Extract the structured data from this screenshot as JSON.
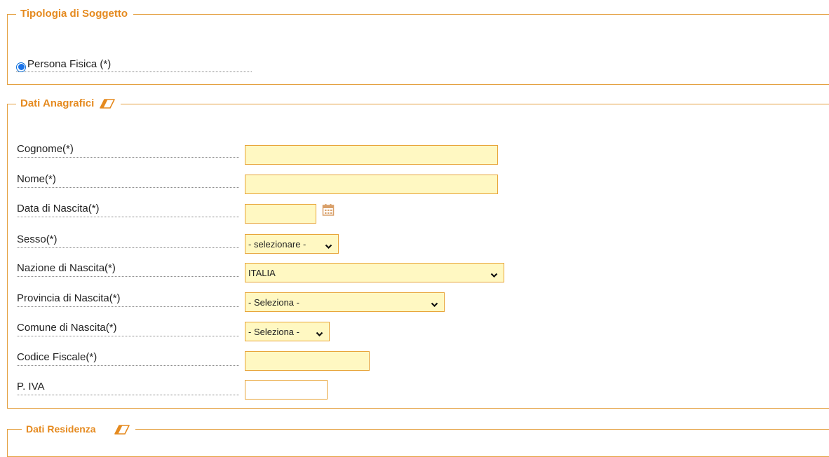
{
  "tipologia": {
    "legend": "Tipologia di Soggetto",
    "radio_label": "Persona Fisica (*)",
    "radio_selected": true
  },
  "anagrafici": {
    "legend": "Dati Anagrafici",
    "legend_icon": "eraser-icon",
    "fields": {
      "cognome": {
        "label": "Cognome(*)",
        "value": ""
      },
      "nome": {
        "label": "Nome(*)",
        "value": ""
      },
      "data_nascita": {
        "label": "Data di Nascita(*)",
        "value": "",
        "icon": "calendar-icon"
      },
      "sesso": {
        "label": "Sesso(*)",
        "selected": "- selezionare -"
      },
      "nazione": {
        "label": "Nazione di Nascita(*)",
        "selected": "ITALIA"
      },
      "provincia": {
        "label": "Provincia di Nascita(*)",
        "selected": "- Seleziona -"
      },
      "comune": {
        "label": "Comune di Nascita(*)",
        "selected": "- Seleziona -"
      },
      "codice_fiscale": {
        "label": "Codice Fiscale(*)",
        "value": ""
      },
      "piva": {
        "label": "P. IVA",
        "value": ""
      }
    }
  },
  "residenza": {
    "legend": "Dati Residenza",
    "legend_icon": "eraser-icon"
  },
  "colors": {
    "accent": "#e58a1f",
    "border": "#e4a040",
    "required_field_bg": "#fff8c2",
    "radio_blue": "#1a73e8"
  }
}
